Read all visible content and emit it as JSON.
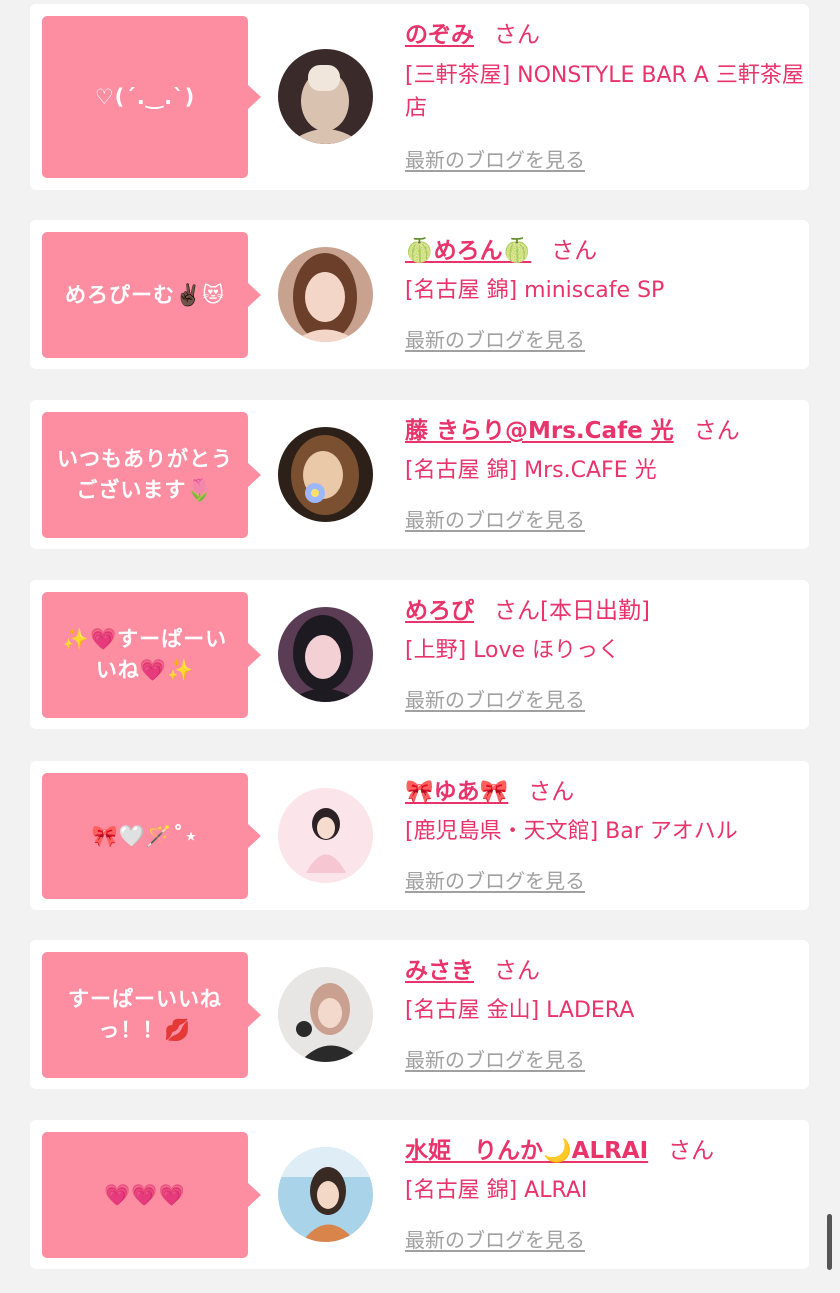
{
  "colors": {
    "background": "#f2f2f2",
    "bubble": "#fd8da1",
    "accent": "#e8336b",
    "link_gray": "#a0a0a0"
  },
  "cards": [
    {
      "message": "♡(ˊ.‿.ˋ)",
      "name": "のぞみ",
      "honorific": "さん",
      "shop": "[三軒茶屋] NONSTYLE BAR A 三軒茶屋店",
      "blog_link": "最新のブログを見る",
      "avatar_colors": [
        "#3a2a2a",
        "#d9c2b0",
        "#f0e6dc"
      ]
    },
    {
      "message": "めろぴーむ✌🏿😻",
      "name": "🍈めろん🍈",
      "honorific": "さん",
      "shop": "[名古屋 錦] miniscafe SP",
      "blog_link": "最新のブログを見る",
      "avatar_colors": [
        "#6b3f2a",
        "#f3d6c8",
        "#c8a28e"
      ]
    },
    {
      "message": "いつもありがとうございます🌷",
      "name": "藤 きらり@Mrs.Cafe 光",
      "honorific": "さん",
      "shop": "[名古屋 錦] Mrs.CAFE 光",
      "blog_link": "最新のブログを見る",
      "avatar_colors": [
        "#7a5030",
        "#e9c9a8",
        "#9db7ff"
      ]
    },
    {
      "message": "✨💗すーぱーいいね💗✨",
      "name": "めろぴ",
      "honorific": "さん[本日出勤]",
      "shop": "[上野] Love ほりっく",
      "blog_link": "最新のブログを見る",
      "avatar_colors": [
        "#1e1a22",
        "#f2d0d4",
        "#5a3c54"
      ]
    },
    {
      "message": "🎀🤍🪄˚⋆",
      "name": "🎀ゆあ🎀",
      "honorific": "さん",
      "shop": "[鹿児島県・天文館] Bar アオハル",
      "blog_link": "最新のブログを見る",
      "avatar_colors": [
        "#fbe4ea",
        "#2c2226",
        "#f7c6d3"
      ]
    },
    {
      "message": "すーぱーいいねっ！！💋",
      "name": "みさき",
      "honorific": "さん",
      "shop": "[名古屋 金山] LADERA",
      "blog_link": "最新のブログを見る",
      "avatar_colors": [
        "#e8e6e4",
        "#caa090",
        "#2a2a2a"
      ]
    },
    {
      "message": "💗💗💗",
      "name": "水姫　りんか🌙ALRAI",
      "honorific": "さん",
      "shop": "[名古屋 錦] ALRAI",
      "blog_link": "最新のブログを見る",
      "avatar_colors": [
        "#a9d3e8",
        "#3a2a24",
        "#d8844a"
      ]
    }
  ]
}
